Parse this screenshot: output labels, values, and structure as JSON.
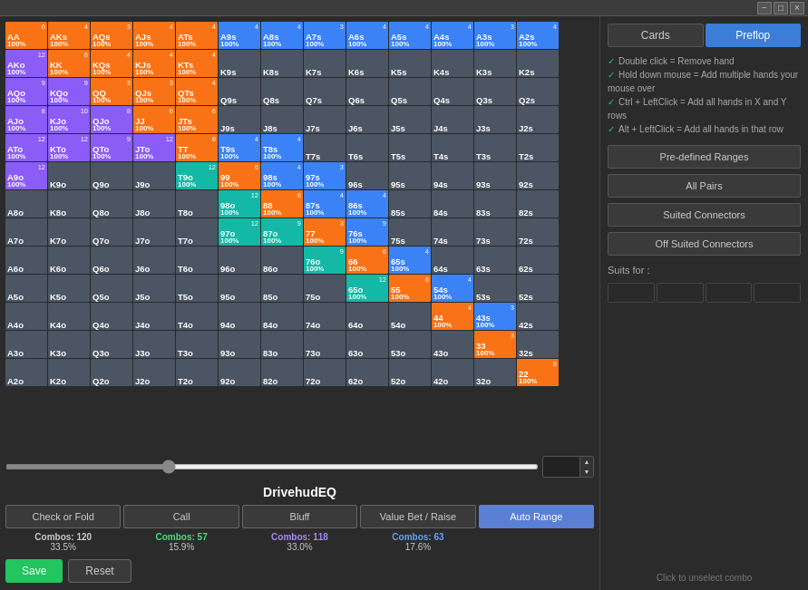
{
  "topbar": {
    "minimize": "−",
    "maximize": "□",
    "close": "×"
  },
  "title": "DrivehudEQ",
  "tabs": {
    "cards": "Cards",
    "preflop": "Preflop"
  },
  "info": {
    "line1": "Double click = Remove hand",
    "line2": "Hold down mouse = Add multiple hands your mouse over",
    "line3": "Ctrl + LeftClick = Add all hands in X and Y rows",
    "line4": "Alt + LeftClick = Add all hands in that row"
  },
  "range_buttons": {
    "predefined": "Pre-defined Ranges",
    "all_pairs": "All Pairs",
    "suited": "Suited Connectors",
    "offsuited": "Off Suited Connectors"
  },
  "suits_for": "Suits for :",
  "unselect": "Click to unselect combo",
  "slider": {
    "value": "30.0"
  },
  "action_buttons": {
    "fold": "Check or Fold",
    "call": "Call",
    "bluff": "Bluff",
    "value": "Value Bet / Raise",
    "auto": "Auto Range"
  },
  "combos": {
    "fold": {
      "count": "Combos: 120",
      "pct": "33.5%"
    },
    "call": {
      "count": "Combos: 57",
      "pct": "15.9%"
    },
    "bluff": {
      "count": "Combos: 118",
      "pct": "33.0%"
    },
    "value": {
      "count": "Combos: 63",
      "pct": "17.6%"
    }
  },
  "bottom_buttons": {
    "save": "Save",
    "reset": "Reset"
  },
  "grid": [
    [
      {
        "hand": "AA",
        "count": "6",
        "pct": "100%",
        "color": "c-orange"
      },
      {
        "hand": "AKs",
        "count": "4",
        "pct": "100%",
        "color": "c-orange"
      },
      {
        "hand": "AQs",
        "count": "3",
        "pct": "100%",
        "color": "c-orange"
      },
      {
        "hand": "AJs",
        "count": "4",
        "pct": "100%",
        "color": "c-orange"
      },
      {
        "hand": "ATs",
        "count": "4",
        "pct": "100%",
        "color": "c-orange"
      },
      {
        "hand": "A9s",
        "count": "4",
        "pct": "100%",
        "color": "c-blue"
      },
      {
        "hand": "A8s",
        "count": "4",
        "pct": "100%",
        "color": "c-blue"
      },
      {
        "hand": "A7s",
        "count": "3",
        "pct": "100%",
        "color": "c-blue"
      },
      {
        "hand": "A6s",
        "count": "4",
        "pct": "100%",
        "color": "c-blue"
      },
      {
        "hand": "A5s",
        "count": "4",
        "pct": "100%",
        "color": "c-blue"
      },
      {
        "hand": "A4s",
        "count": "4",
        "pct": "100%",
        "color": "c-blue"
      },
      {
        "hand": "A3s",
        "count": "3",
        "pct": "100%",
        "color": "c-blue"
      },
      {
        "hand": "A2s",
        "count": "4",
        "pct": "100%",
        "color": "c-blue"
      }
    ],
    [
      {
        "hand": "AKo",
        "count": "12",
        "pct": "100%",
        "color": "c-purple"
      },
      {
        "hand": "KK",
        "count": "6",
        "pct": "100%",
        "color": "c-orange"
      },
      {
        "hand": "KQs",
        "count": "4",
        "pct": "100%",
        "color": "c-orange"
      },
      {
        "hand": "KJs",
        "count": "4",
        "pct": "100%",
        "color": "c-orange"
      },
      {
        "hand": "KTs",
        "count": "4",
        "pct": "100%",
        "color": "c-orange"
      },
      {
        "hand": "K9s",
        "count": "",
        "pct": "",
        "color": "c-gray"
      },
      {
        "hand": "K8s",
        "count": "",
        "pct": "",
        "color": "c-gray"
      },
      {
        "hand": "K7s",
        "count": "",
        "pct": "",
        "color": "c-gray"
      },
      {
        "hand": "K6s",
        "count": "",
        "pct": "",
        "color": "c-gray"
      },
      {
        "hand": "K5s",
        "count": "",
        "pct": "",
        "color": "c-gray"
      },
      {
        "hand": "K4s",
        "count": "",
        "pct": "",
        "color": "c-gray"
      },
      {
        "hand": "K3s",
        "count": "",
        "pct": "",
        "color": "c-gray"
      },
      {
        "hand": "K2s",
        "count": "",
        "pct": "",
        "color": "c-gray"
      }
    ],
    [
      {
        "hand": "AQo",
        "count": "9",
        "pct": "100%",
        "color": "c-purple"
      },
      {
        "hand": "KQo",
        "count": "9",
        "pct": "100%",
        "color": "c-purple"
      },
      {
        "hand": "QQ",
        "count": "3",
        "pct": "100%",
        "color": "c-orange"
      },
      {
        "hand": "QJs",
        "count": "3",
        "pct": "100%",
        "color": "c-orange"
      },
      {
        "hand": "QTs",
        "count": "4",
        "pct": "100%",
        "color": "c-orange"
      },
      {
        "hand": "Q9s",
        "count": "",
        "pct": "",
        "color": "c-gray"
      },
      {
        "hand": "Q8s",
        "count": "",
        "pct": "",
        "color": "c-gray"
      },
      {
        "hand": "Q7s",
        "count": "",
        "pct": "",
        "color": "c-gray"
      },
      {
        "hand": "Q6s",
        "count": "",
        "pct": "",
        "color": "c-gray"
      },
      {
        "hand": "Q5s",
        "count": "",
        "pct": "",
        "color": "c-gray"
      },
      {
        "hand": "Q4s",
        "count": "",
        "pct": "",
        "color": "c-gray"
      },
      {
        "hand": "Q3s",
        "count": "",
        "pct": "",
        "color": "c-gray"
      },
      {
        "hand": "Q2s",
        "count": "",
        "pct": "",
        "color": "c-gray"
      }
    ],
    [
      {
        "hand": "AJo",
        "count": "8",
        "pct": "100%",
        "color": "c-purple"
      },
      {
        "hand": "KJo",
        "count": "10",
        "pct": "100%",
        "color": "c-purple"
      },
      {
        "hand": "QJo",
        "count": "8",
        "pct": "100%",
        "color": "c-purple"
      },
      {
        "hand": "JJ",
        "count": "6",
        "pct": "100%",
        "color": "c-orange"
      },
      {
        "hand": "JTs",
        "count": "6",
        "pct": "100%",
        "color": "c-orange"
      },
      {
        "hand": "J9s",
        "count": "",
        "pct": "",
        "color": "c-gray"
      },
      {
        "hand": "J8s",
        "count": "",
        "pct": "",
        "color": "c-gray"
      },
      {
        "hand": "J7s",
        "count": "",
        "pct": "",
        "color": "c-gray"
      },
      {
        "hand": "J6s",
        "count": "",
        "pct": "",
        "color": "c-gray"
      },
      {
        "hand": "J5s",
        "count": "",
        "pct": "",
        "color": "c-gray"
      },
      {
        "hand": "J4s",
        "count": "",
        "pct": "",
        "color": "c-gray"
      },
      {
        "hand": "J3s",
        "count": "",
        "pct": "",
        "color": "c-gray"
      },
      {
        "hand": "J2s",
        "count": "",
        "pct": "",
        "color": "c-gray"
      }
    ],
    [
      {
        "hand": "ATo",
        "count": "12",
        "pct": "100%",
        "color": "c-purple"
      },
      {
        "hand": "KTo",
        "count": "12",
        "pct": "100%",
        "color": "c-purple"
      },
      {
        "hand": "QTo",
        "count": "9",
        "pct": "100%",
        "color": "c-purple"
      },
      {
        "hand": "JTo",
        "count": "12",
        "pct": "100%",
        "color": "c-purple"
      },
      {
        "hand": "TT",
        "count": "6",
        "pct": "100%",
        "color": "c-orange"
      },
      {
        "hand": "T9s",
        "count": "4",
        "pct": "100%",
        "color": "c-blue"
      },
      {
        "hand": "T8s",
        "count": "4",
        "pct": "100%",
        "color": "c-blue"
      },
      {
        "hand": "T7s",
        "count": "",
        "pct": "",
        "color": "c-gray"
      },
      {
        "hand": "T6s",
        "count": "",
        "pct": "",
        "color": "c-gray"
      },
      {
        "hand": "T5s",
        "count": "",
        "pct": "",
        "color": "c-gray"
      },
      {
        "hand": "T4s",
        "count": "",
        "pct": "",
        "color": "c-gray"
      },
      {
        "hand": "T3s",
        "count": "",
        "pct": "",
        "color": "c-gray"
      },
      {
        "hand": "T2s",
        "count": "",
        "pct": "",
        "color": "c-gray"
      }
    ],
    [
      {
        "hand": "A9o",
        "count": "12",
        "pct": "100%",
        "color": "c-purple"
      },
      {
        "hand": "K9o",
        "count": "",
        "pct": "",
        "color": "c-gray"
      },
      {
        "hand": "Q9o",
        "count": "",
        "pct": "",
        "color": "c-gray"
      },
      {
        "hand": "J9o",
        "count": "",
        "pct": "",
        "color": "c-gray"
      },
      {
        "hand": "T9o",
        "count": "12",
        "pct": "100%",
        "color": "c-teal"
      },
      {
        "hand": "99",
        "count": "6",
        "pct": "100%",
        "color": "c-orange"
      },
      {
        "hand": "98s",
        "count": "4",
        "pct": "100%",
        "color": "c-blue"
      },
      {
        "hand": "97s",
        "count": "3",
        "pct": "100%",
        "color": "c-blue"
      },
      {
        "hand": "96s",
        "count": "",
        "pct": "",
        "color": "c-gray"
      },
      {
        "hand": "95s",
        "count": "",
        "pct": "",
        "color": "c-gray"
      },
      {
        "hand": "94s",
        "count": "",
        "pct": "",
        "color": "c-gray"
      },
      {
        "hand": "93s",
        "count": "",
        "pct": "",
        "color": "c-gray"
      },
      {
        "hand": "92s",
        "count": "",
        "pct": "",
        "color": "c-gray"
      }
    ],
    [
      {
        "hand": "A8o",
        "count": "",
        "pct": "",
        "color": "c-gray"
      },
      {
        "hand": "K8o",
        "count": "",
        "pct": "",
        "color": "c-gray"
      },
      {
        "hand": "Q8o",
        "count": "",
        "pct": "",
        "color": "c-gray"
      },
      {
        "hand": "J8o",
        "count": "",
        "pct": "",
        "color": "c-gray"
      },
      {
        "hand": "T8o",
        "count": "",
        "pct": "",
        "color": "c-gray"
      },
      {
        "hand": "98o",
        "count": "12",
        "pct": "100%",
        "color": "c-teal"
      },
      {
        "hand": "88",
        "count": "6",
        "pct": "100%",
        "color": "c-orange"
      },
      {
        "hand": "87s",
        "count": "4",
        "pct": "100%",
        "color": "c-blue"
      },
      {
        "hand": "86s",
        "count": "4",
        "pct": "100%",
        "color": "c-blue"
      },
      {
        "hand": "85s",
        "count": "",
        "pct": "",
        "color": "c-gray"
      },
      {
        "hand": "84s",
        "count": "",
        "pct": "",
        "color": "c-gray"
      },
      {
        "hand": "83s",
        "count": "",
        "pct": "",
        "color": "c-gray"
      },
      {
        "hand": "82s",
        "count": "",
        "pct": "",
        "color": "c-gray"
      }
    ],
    [
      {
        "hand": "A7o",
        "count": "",
        "pct": "",
        "color": "c-gray"
      },
      {
        "hand": "K7o",
        "count": "",
        "pct": "",
        "color": "c-gray"
      },
      {
        "hand": "Q7o",
        "count": "",
        "pct": "",
        "color": "c-gray"
      },
      {
        "hand": "J7o",
        "count": "",
        "pct": "",
        "color": "c-gray"
      },
      {
        "hand": "T7o",
        "count": "",
        "pct": "",
        "color": "c-gray"
      },
      {
        "hand": "97o",
        "count": "12",
        "pct": "100%",
        "color": "c-teal"
      },
      {
        "hand": "87o",
        "count": "9",
        "pct": "100%",
        "color": "c-teal"
      },
      {
        "hand": "77",
        "count": "3",
        "pct": "100%",
        "color": "c-orange"
      },
      {
        "hand": "76s",
        "count": "9",
        "pct": "100%",
        "color": "c-blue"
      },
      {
        "hand": "75s",
        "count": "",
        "pct": "",
        "color": "c-gray"
      },
      {
        "hand": "74s",
        "count": "",
        "pct": "",
        "color": "c-gray"
      },
      {
        "hand": "73s",
        "count": "",
        "pct": "",
        "color": "c-gray"
      },
      {
        "hand": "72s",
        "count": "",
        "pct": "",
        "color": "c-gray"
      }
    ],
    [
      {
        "hand": "A6o",
        "count": "",
        "pct": "",
        "color": "c-gray"
      },
      {
        "hand": "K6o",
        "count": "",
        "pct": "",
        "color": "c-gray"
      },
      {
        "hand": "Q6o",
        "count": "",
        "pct": "",
        "color": "c-gray"
      },
      {
        "hand": "J6o",
        "count": "",
        "pct": "",
        "color": "c-gray"
      },
      {
        "hand": "T6o",
        "count": "",
        "pct": "",
        "color": "c-gray"
      },
      {
        "hand": "96o",
        "count": "",
        "pct": "",
        "color": "c-gray"
      },
      {
        "hand": "86o",
        "count": "",
        "pct": "",
        "color": "c-gray"
      },
      {
        "hand": "76o",
        "count": "9",
        "pct": "100%",
        "color": "c-teal"
      },
      {
        "hand": "66",
        "count": "6",
        "pct": "100%",
        "color": "c-orange"
      },
      {
        "hand": "65s",
        "count": "4",
        "pct": "100%",
        "color": "c-blue"
      },
      {
        "hand": "64s",
        "count": "",
        "pct": "",
        "color": "c-gray"
      },
      {
        "hand": "63s",
        "count": "",
        "pct": "",
        "color": "c-gray"
      },
      {
        "hand": "62s",
        "count": "",
        "pct": "",
        "color": "c-gray"
      }
    ],
    [
      {
        "hand": "A5o",
        "count": "",
        "pct": "",
        "color": "c-gray"
      },
      {
        "hand": "K5o",
        "count": "",
        "pct": "",
        "color": "c-gray"
      },
      {
        "hand": "Q5o",
        "count": "",
        "pct": "",
        "color": "c-gray"
      },
      {
        "hand": "J5o",
        "count": "",
        "pct": "",
        "color": "c-gray"
      },
      {
        "hand": "T5o",
        "count": "",
        "pct": "",
        "color": "c-gray"
      },
      {
        "hand": "95o",
        "count": "",
        "pct": "",
        "color": "c-gray"
      },
      {
        "hand": "85o",
        "count": "",
        "pct": "",
        "color": "c-gray"
      },
      {
        "hand": "75o",
        "count": "",
        "pct": "",
        "color": "c-gray"
      },
      {
        "hand": "65o",
        "count": "12",
        "pct": "100%",
        "color": "c-teal"
      },
      {
        "hand": "55",
        "count": "6",
        "pct": "100%",
        "color": "c-orange"
      },
      {
        "hand": "54s",
        "count": "4",
        "pct": "100%",
        "color": "c-blue"
      },
      {
        "hand": "53s",
        "count": "",
        "pct": "",
        "color": "c-gray"
      },
      {
        "hand": "52s",
        "count": "",
        "pct": "",
        "color": "c-gray"
      }
    ],
    [
      {
        "hand": "A4o",
        "count": "",
        "pct": "",
        "color": "c-gray"
      },
      {
        "hand": "K4o",
        "count": "",
        "pct": "",
        "color": "c-gray"
      },
      {
        "hand": "Q4o",
        "count": "",
        "pct": "",
        "color": "c-gray"
      },
      {
        "hand": "J4o",
        "count": "",
        "pct": "",
        "color": "c-gray"
      },
      {
        "hand": "T4o",
        "count": "",
        "pct": "",
        "color": "c-gray"
      },
      {
        "hand": "94o",
        "count": "",
        "pct": "",
        "color": "c-gray"
      },
      {
        "hand": "84o",
        "count": "",
        "pct": "",
        "color": "c-gray"
      },
      {
        "hand": "74o",
        "count": "",
        "pct": "",
        "color": "c-gray"
      },
      {
        "hand": "64o",
        "count": "",
        "pct": "",
        "color": "c-gray"
      },
      {
        "hand": "54o",
        "count": "",
        "pct": "",
        "color": "c-gray"
      },
      {
        "hand": "44",
        "count": "4",
        "pct": "100%",
        "color": "c-orange"
      },
      {
        "hand": "43s",
        "count": "3",
        "pct": "100%",
        "color": "c-blue"
      },
      {
        "hand": "42s",
        "count": "",
        "pct": "",
        "color": "c-gray"
      }
    ],
    [
      {
        "hand": "A3o",
        "count": "",
        "pct": "",
        "color": "c-gray"
      },
      {
        "hand": "K3o",
        "count": "",
        "pct": "",
        "color": "c-gray"
      },
      {
        "hand": "Q3o",
        "count": "",
        "pct": "",
        "color": "c-gray"
      },
      {
        "hand": "J3o",
        "count": "",
        "pct": "",
        "color": "c-gray"
      },
      {
        "hand": "T3o",
        "count": "",
        "pct": "",
        "color": "c-gray"
      },
      {
        "hand": "93o",
        "count": "",
        "pct": "",
        "color": "c-gray"
      },
      {
        "hand": "83o",
        "count": "",
        "pct": "",
        "color": "c-gray"
      },
      {
        "hand": "73o",
        "count": "",
        "pct": "",
        "color": "c-gray"
      },
      {
        "hand": "63o",
        "count": "",
        "pct": "",
        "color": "c-gray"
      },
      {
        "hand": "53o",
        "count": "",
        "pct": "",
        "color": "c-gray"
      },
      {
        "hand": "43o",
        "count": "",
        "pct": "",
        "color": "c-gray"
      },
      {
        "hand": "33",
        "count": "3",
        "pct": "100%",
        "color": "c-orange"
      },
      {
        "hand": "32s",
        "count": "",
        "pct": "",
        "color": "c-gray"
      }
    ],
    [
      {
        "hand": "A2o",
        "count": "",
        "pct": "",
        "color": "c-gray"
      },
      {
        "hand": "K2o",
        "count": "",
        "pct": "",
        "color": "c-gray"
      },
      {
        "hand": "Q2o",
        "count": "",
        "pct": "",
        "color": "c-gray"
      },
      {
        "hand": "J2o",
        "count": "",
        "pct": "",
        "color": "c-gray"
      },
      {
        "hand": "T2o",
        "count": "",
        "pct": "",
        "color": "c-gray"
      },
      {
        "hand": "92o",
        "count": "",
        "pct": "",
        "color": "c-gray"
      },
      {
        "hand": "82o",
        "count": "",
        "pct": "",
        "color": "c-gray"
      },
      {
        "hand": "72o",
        "count": "",
        "pct": "",
        "color": "c-gray"
      },
      {
        "hand": "62o",
        "count": "",
        "pct": "",
        "color": "c-gray"
      },
      {
        "hand": "52o",
        "count": "",
        "pct": "",
        "color": "c-gray"
      },
      {
        "hand": "42o",
        "count": "",
        "pct": "",
        "color": "c-gray"
      },
      {
        "hand": "32o",
        "count": "",
        "pct": "",
        "color": "c-gray"
      },
      {
        "hand": "22",
        "count": "6",
        "pct": "100%",
        "color": "c-orange"
      }
    ]
  ]
}
